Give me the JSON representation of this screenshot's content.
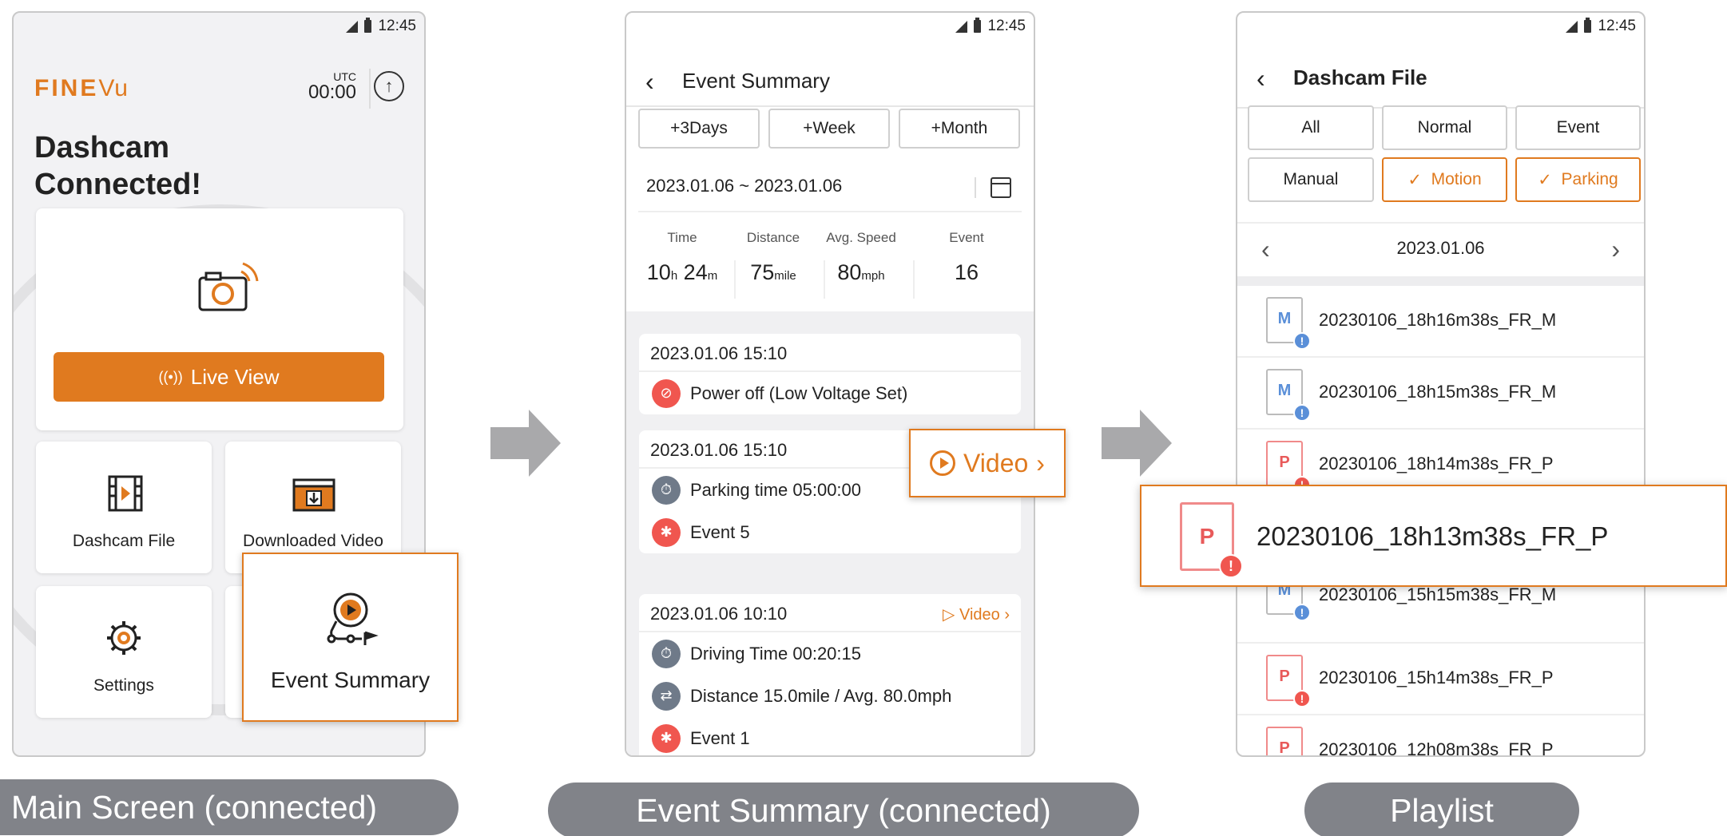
{
  "status_bar": {
    "time": "12:45"
  },
  "main_screen": {
    "logo_text": "FINE",
    "logo_text2": "Vu",
    "utc_label": "UTC",
    "utc_time": "00:00",
    "title_line1": "Dashcam",
    "title_line2": "Connected!",
    "live_view_label": "Live View",
    "tiles": [
      {
        "label": "Dashcam File",
        "icon": "film-icon"
      },
      {
        "label": "Downloaded Video",
        "icon": "folder-download-icon"
      },
      {
        "label": "Settings",
        "icon": "gear-icon"
      }
    ],
    "highlight_label": "Event Summary"
  },
  "event_summary": {
    "title": "Event Summary",
    "ranges": [
      "+3Days",
      "+Week",
      "+Month"
    ],
    "date_range": "2023.01.06 ~ 2023.01.06",
    "stats": [
      {
        "label": "Time",
        "v1": "10",
        "u1": "h",
        "v2": "24",
        "u2": "m"
      },
      {
        "label": "Distance",
        "v1": "75",
        "u1": "mile"
      },
      {
        "label": "Avg. Speed",
        "v1": "80",
        "u1": "mph"
      },
      {
        "label": "Event",
        "v1": "16"
      }
    ],
    "cards": [
      {
        "time": "2023.01.06 15:10",
        "rows": [
          "Power off (Low Voltage Set)"
        ]
      },
      {
        "time": "2023.01.06 15:10",
        "rows": [
          "Parking time  05:00:00",
          "Event  5"
        ]
      },
      {
        "time": "2023.01.06 10:10",
        "video": "Video",
        "rows": [
          "Driving Time  00:20:15",
          "Distance 15.0mile / Avg. 80.0mph",
          "Event  1"
        ]
      }
    ],
    "video_popup": "Video"
  },
  "playlist": {
    "title": "Dashcam File",
    "filters": [
      {
        "label": "All",
        "selected": false
      },
      {
        "label": "Normal",
        "selected": false
      },
      {
        "label": "Event",
        "selected": false
      },
      {
        "label": "Manual",
        "selected": false
      },
      {
        "label": "Motion",
        "selected": true
      },
      {
        "label": "Parking",
        "selected": true
      }
    ],
    "date": "2023.01.06",
    "files": [
      {
        "letter": "M",
        "name": "20230106_18h16m38s_FR_M"
      },
      {
        "letter": "M",
        "name": "20230106_18h15m38s_FR_M"
      },
      {
        "letter": "P",
        "name": "20230106_18h14m38s_FR_P"
      },
      {
        "letter": "M",
        "name": "20230106_15h15m38s_FR_M"
      },
      {
        "letter": "P",
        "name": "20230106_15h14m38s_FR_P"
      },
      {
        "letter": "P",
        "name": "20230106_12h08m38s_FR_P"
      }
    ],
    "popup_letter": "P",
    "popup_name": "20230106_18h13m38s_FR_P"
  },
  "captions": {
    "main": "Main Screen (connected)",
    "event": "Event Summary (connected)",
    "playlist": "Playlist"
  },
  "colors": {
    "accent": "#e07a1f",
    "alert": "#f0564f",
    "motion_blue": "#5a8fd8",
    "caption_bg": "#818389"
  }
}
